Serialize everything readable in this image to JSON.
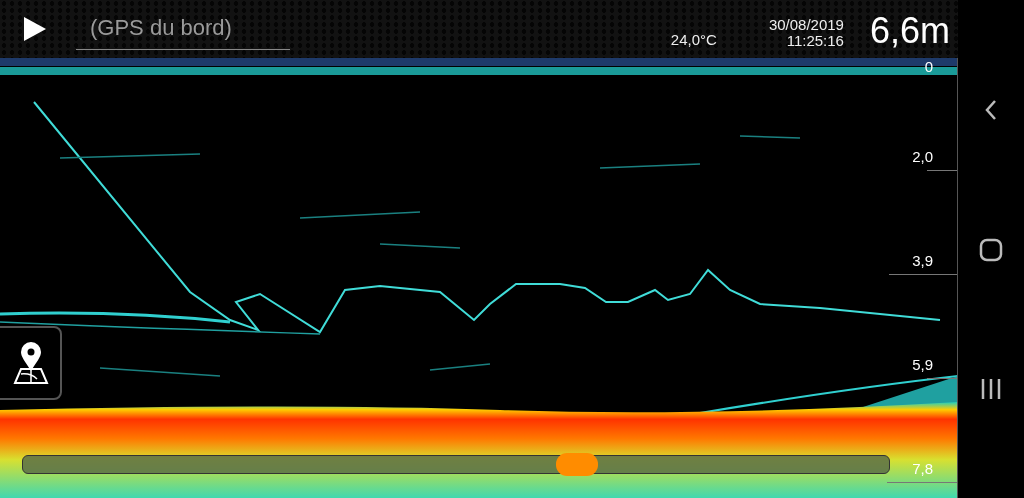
{
  "header": {
    "source_field": {
      "placeholder": "(GPS du bord)"
    },
    "temperature": "24,0°C",
    "date": "30/08/2019",
    "time": "11:25:16",
    "depth": "6,6m"
  },
  "depth_scale": [
    "0",
    "2,0",
    "3,9",
    "5,9",
    "7,8"
  ],
  "history_slider": {
    "level": 0.64
  }
}
